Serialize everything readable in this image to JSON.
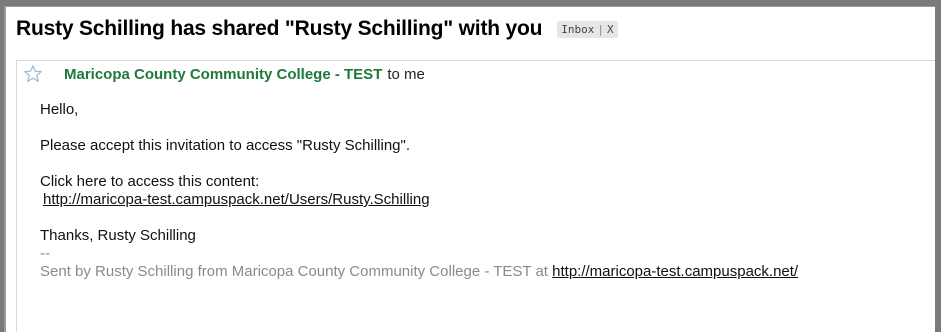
{
  "subject": {
    "title": "Rusty Schilling has shared \"Rusty Schilling\" with you",
    "label": "Inbox",
    "label_remove": "X"
  },
  "message": {
    "sender": "Maricopa County Community College - TEST",
    "recipient": "to me",
    "greeting": "Hello,",
    "invitation": "Please accept this invitation to access \"Rusty Schilling\".",
    "access_prompt": "Click here to access this content:",
    "access_link": "http://maricopa-test.campuspack.net/Users/Rusty.Schilling",
    "signoff": "Thanks, Rusty Schilling",
    "sig_separator": "--",
    "footer_text": "Sent by Rusty Schilling from Maricopa County Community College - TEST at ",
    "footer_link": "http://maricopa-test.campuspack.net/"
  },
  "icons": {
    "star": "star-outline-icon"
  },
  "colors": {
    "sender": "#1f7a3a",
    "footer_text": "#8a8a8a",
    "star_stroke": "#9ab8d8"
  }
}
